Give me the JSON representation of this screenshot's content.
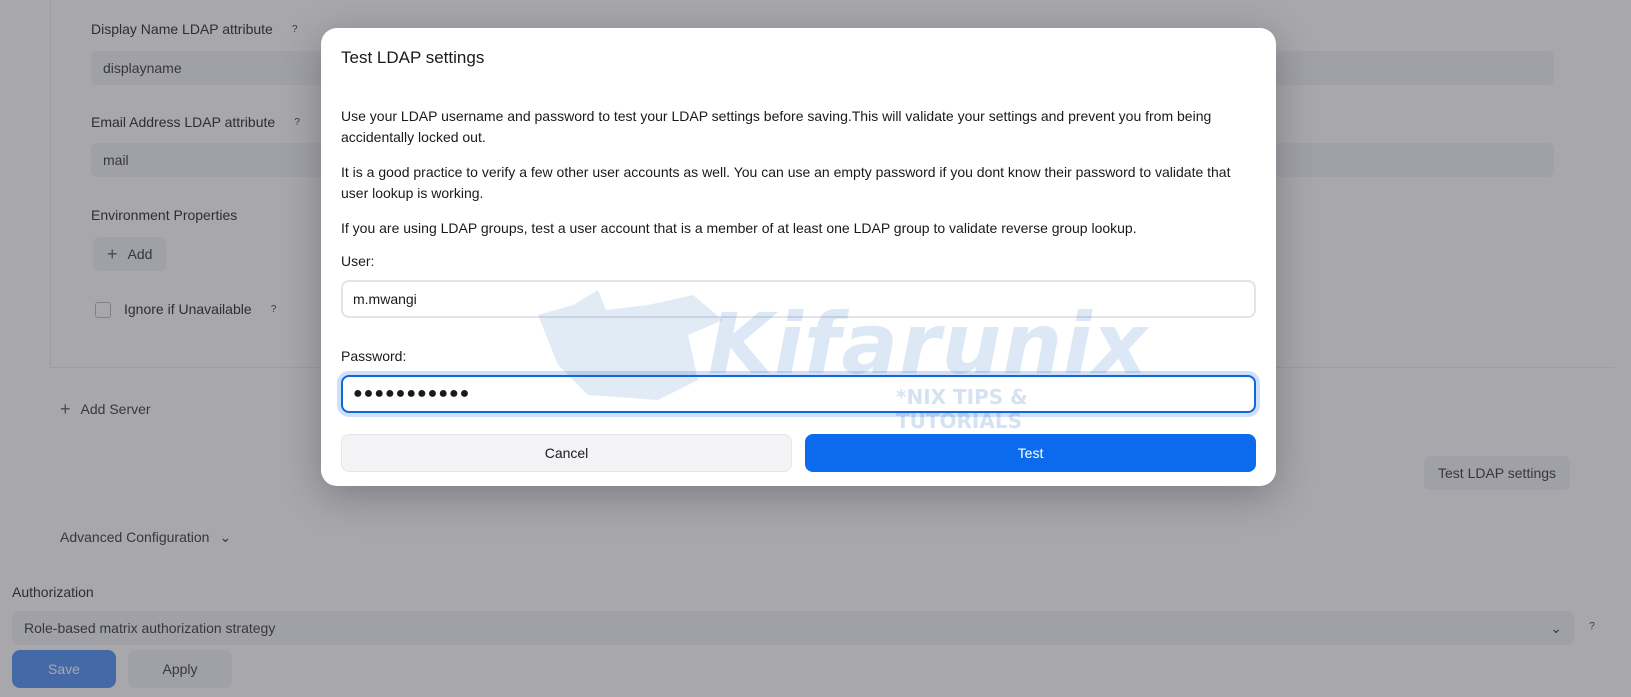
{
  "background": {
    "display_name_label": "Display Name LDAP attribute",
    "display_name_value": "displayname",
    "email_label": "Email Address LDAP attribute",
    "email_value": "mail",
    "env_props_label": "Environment Properties",
    "add_label": "Add",
    "ignore_label": "Ignore if Unavailable",
    "add_server_label": "Add Server",
    "test_ldap_label": "Test LDAP settings",
    "advanced_label": "Advanced Configuration",
    "authorization_label": "Authorization",
    "authorization_value": "Role-based matrix authorization strategy",
    "help_glyph": "?",
    "plus_glyph": "+",
    "chevron_glyph": "⌄",
    "save_label": "Save",
    "apply_label": "Apply"
  },
  "dialog": {
    "title": "Test LDAP settings",
    "para1": "Use your LDAP username and password to test your LDAP settings before saving.This will validate your settings and prevent you from being accidentally locked out.",
    "para2": "It is a good practice to verify a few other user accounts as well. You can use an empty password if you dont know their password to validate that user lookup is working.",
    "para3": "If you are using LDAP groups, test a user account that is a member of at least one LDAP group to validate reverse group lookup.",
    "user_label": "User:",
    "user_value": "m.mwangi",
    "password_label": "Password:",
    "password_value": "●●●●●●●●●●●",
    "cancel_label": "Cancel",
    "test_label": "Test"
  },
  "watermark": {
    "name": "Kifarunix",
    "tagline": "*NIX TIPS & TUTORIALS"
  },
  "colors": {
    "primary": "#0b6bec",
    "save_disabled": "#4c8ef4",
    "overlay": "rgba(60,60,72,0.45)"
  }
}
